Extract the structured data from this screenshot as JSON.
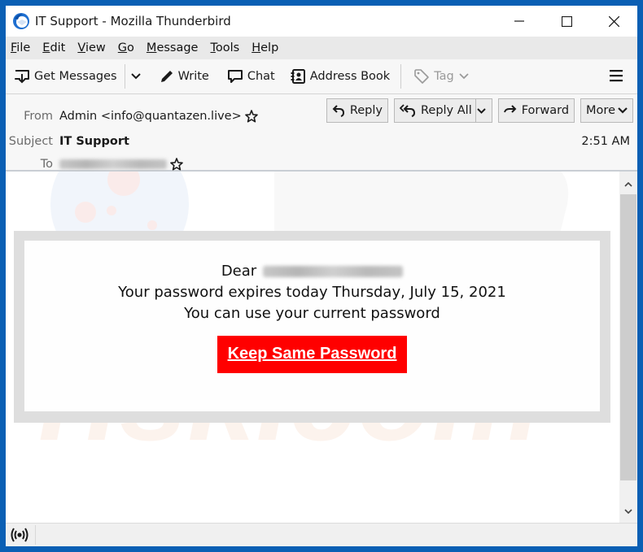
{
  "window": {
    "title": "IT Support - Mozilla Thunderbird",
    "app_icon": "thunderbird-logo-icon",
    "controls": [
      "minimize-icon",
      "maximize-icon",
      "close-icon"
    ]
  },
  "menubar": {
    "items": [
      {
        "label": "File",
        "accel": "F",
        "rest": "ile"
      },
      {
        "label": "Edit",
        "accel": "E",
        "rest": "dit"
      },
      {
        "label": "View",
        "accel": "V",
        "rest": "iew"
      },
      {
        "label": "Go",
        "accel": "G",
        "rest": "o"
      },
      {
        "label": "Message",
        "accel": "M",
        "rest": "essage"
      },
      {
        "label": "Tools",
        "accel": "T",
        "rest": "ools"
      },
      {
        "label": "Help",
        "accel": "H",
        "rest": "elp"
      }
    ]
  },
  "toolbar": {
    "get_messages": "Get Messages",
    "write": "Write",
    "chat": "Chat",
    "address_book": "Address Book",
    "tag": "Tag"
  },
  "header": {
    "from_label": "From",
    "from_value": "Admin <info@quantazen.live>",
    "subject_label": "Subject",
    "subject_value": "IT Support",
    "to_label": "To",
    "to_value_redacted": "[redacted email]",
    "time": "2:51 AM",
    "actions": {
      "reply": "Reply",
      "reply_all": "Reply All",
      "forward": "Forward",
      "more": "More"
    }
  },
  "email": {
    "greeting": "Dear",
    "recipient_redacted": "[redacted email]",
    "line2": "Your password expires today Thursday, July 15, 2021",
    "line3": "You can use your current password",
    "cta_label": "Keep Same Password",
    "cta_color": "#ff0000"
  },
  "colors": {
    "window_frame": "#0a5fb4",
    "cta_bg": "#ff0000"
  },
  "statusbar": {
    "icon": "online-status-icon"
  }
}
